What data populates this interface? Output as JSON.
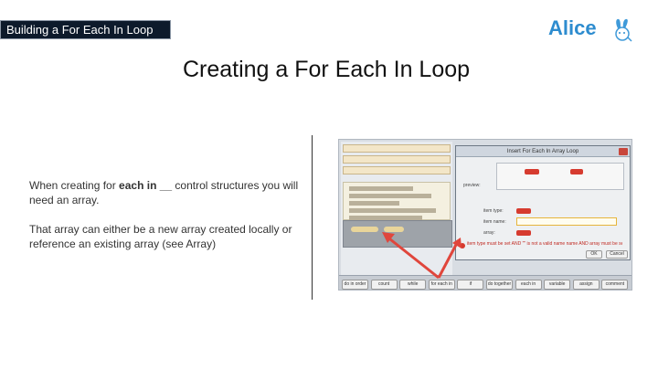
{
  "header": {
    "section_tag": "Building a For Each In Loop"
  },
  "logo": {
    "text": "Alice",
    "icon": "alice-bunny-icon",
    "color": "#2d8ccf"
  },
  "slide": {
    "title": "Creating a For Each In Loop",
    "paragraph1_before": "When creating for ",
    "paragraph1_bold": "each in __",
    "paragraph1_after": " control structures you will need an array.",
    "paragraph2": "That array can either be a new array created locally or reference an existing array (see Array)"
  },
  "screenshot": {
    "dialog_title": "Insert For Each In Array Loop",
    "item_type_label": "item type:",
    "item_name_label": "item name:",
    "array_label": "array:",
    "preview_label": "preview:",
    "warning": "item type must be set AND \"\" is not a valid name name AND array must be set.",
    "ok_label": "OK",
    "cancel_label": "Cancel",
    "tabs": [
      "do in order",
      "count",
      "while",
      "for each in",
      "if",
      "do together",
      "each in",
      "variable",
      "assign",
      "comment"
    ],
    "accent_red": "#d63b2f",
    "arrow_color": "#e0463c"
  }
}
